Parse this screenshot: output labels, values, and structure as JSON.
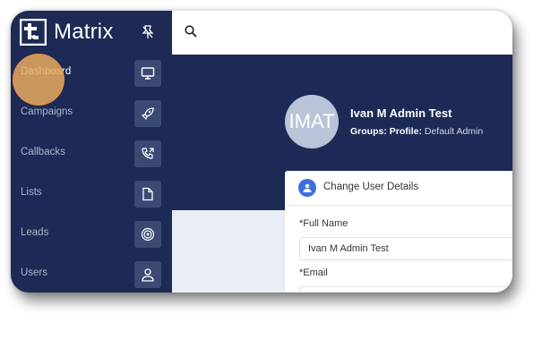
{
  "app": {
    "title": "Matrix"
  },
  "sidebar": {
    "items": [
      {
        "label": "Dashboard",
        "icon": "monitor-icon",
        "active": true
      },
      {
        "label": "Campaigns",
        "icon": "rocket-icon"
      },
      {
        "label": "Callbacks",
        "icon": "phone-callback-icon"
      },
      {
        "label": "Lists",
        "icon": "document-icon"
      },
      {
        "label": "Leads",
        "icon": "target-icon"
      },
      {
        "label": "Users",
        "icon": "user-icon"
      }
    ]
  },
  "profile": {
    "initials": "IMAT",
    "name": "Ivan M Admin Test",
    "groups_label": "Groups:",
    "profile_label": "Profile:",
    "profile_value": "Default Admin"
  },
  "form": {
    "title": "Change User Details",
    "full_name_label": "*Full Name",
    "full_name_value": "Ivan M Admin Test",
    "email_label": "*Email",
    "email_value": ""
  },
  "colors": {
    "sidebar_bg": "#1c2a55",
    "accent": "#3b6fd9",
    "highlight": "#e8aa60"
  }
}
